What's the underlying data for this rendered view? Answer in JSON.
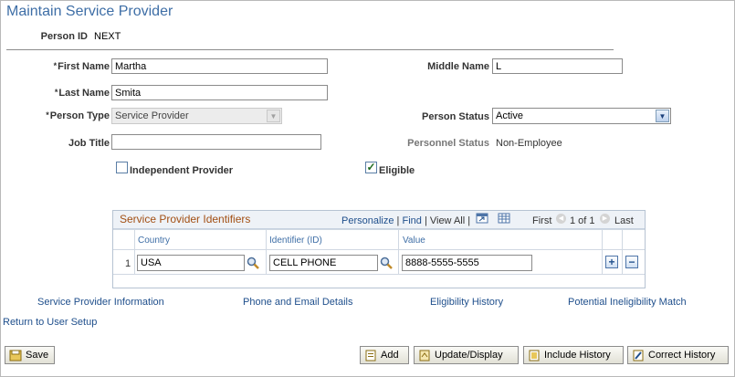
{
  "page": {
    "title": "Maintain Service Provider"
  },
  "person": {
    "id_label": "Person ID",
    "id_value": "NEXT",
    "first_name_label": "First Name",
    "first_name": "Martha",
    "middle_name_label": "Middle Name",
    "middle_name": "L",
    "last_name_label": "Last Name",
    "last_name": "Smita",
    "person_type_label": "Person Type",
    "person_type": "Service Provider",
    "person_status_label": "Person Status",
    "person_status": "Active",
    "job_title_label": "Job Title",
    "job_title": "",
    "personnel_status_label": "Personnel Status",
    "personnel_status": "Non-Employee",
    "independent_provider_label": "Independent Provider",
    "independent_provider_checked": false,
    "eligible_label": "Eligible",
    "eligible_checked": true,
    "required_marker": "*"
  },
  "grid": {
    "title": "Service Provider Identifiers",
    "personalize": "Personalize",
    "find": "Find",
    "separator": "|",
    "view_all": "View All",
    "first": "First",
    "range": "1 of 1",
    "last": "Last",
    "columns": [
      "Country",
      "Identifier (ID)",
      "Value"
    ],
    "rows": [
      {
        "num": "1",
        "country": "USA",
        "identifier": "CELL PHONE",
        "value": "8888-5555-5555"
      }
    ],
    "add_symbol": "+",
    "delete_symbol": "−"
  },
  "links": {
    "service_provider_information": "Service Provider Information",
    "phone_email": "Phone and Email Details",
    "eligibility_history": "Eligibility History",
    "potential_ineligibility": "Potential Ineligibility Match",
    "return_user_setup": "Return to User Setup"
  },
  "toolbar": {
    "save": "Save",
    "add": "Add",
    "update_display": "Update/Display",
    "include_history": "Include History",
    "correct_history": "Correct History"
  },
  "icons": {
    "lookup": "magnifier-icon",
    "save": "save-icon",
    "add": "add-icon",
    "update": "update-icon",
    "history": "history-icon",
    "correct": "correct-history-icon"
  },
  "colors": {
    "title": "#3e6ea6",
    "grid_title": "#a24f13",
    "link": "#1f4f8c"
  }
}
